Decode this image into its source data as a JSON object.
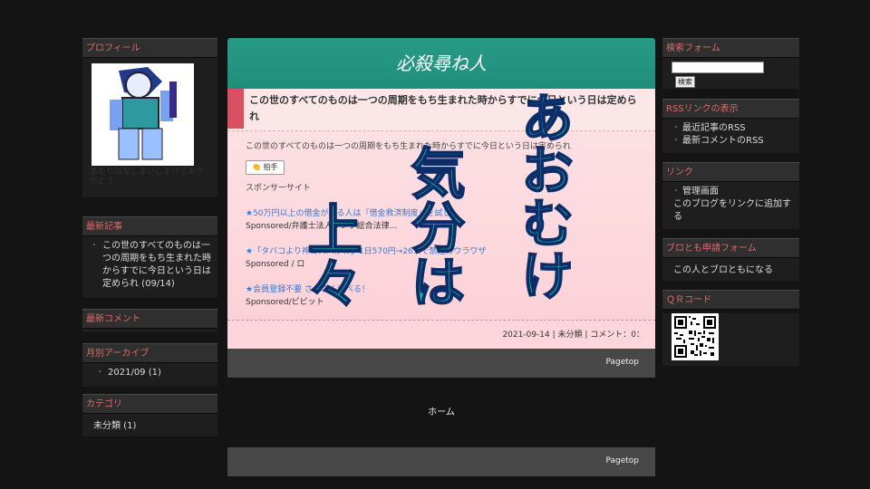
{
  "left": {
    "profile": {
      "title": "プロフィール",
      "text": "あたりはなしまいしまけるありがとう"
    },
    "recent": {
      "title": "最新記事",
      "item": "この世のすべてのものは一つの周期をもち生まれた時からすでに今日という日は定められ (09/14)"
    },
    "comments": {
      "title": "最新コメント"
    },
    "archive": {
      "title": "月別アーカイブ",
      "item": "2021/09 (1)"
    },
    "category": {
      "title": "カテゴリ",
      "item": "未分類 (1)"
    }
  },
  "main": {
    "blog_title": "必殺尋ね人",
    "entry_title": "この世のすべてのものは一つの周期をもち生まれた時からすでに今日という日は定められ",
    "entry_text": "この世のすべてのものは一つの周期をもち生まれた時からすでに今日という日は定められ",
    "clap": "拍手",
    "sponsor": "スポンサーサイト",
    "ads": [
      {
        "link": "★50万円以上の借金がある人は『借金救済制度』を試し",
        "sub": "Sponsored/弁護士法人ランク総合法律..."
      },
      {
        "link": "★「タバコより神コスパかわ」1日570円→26...で禁煙のウラワザ",
        "sub": "Sponsored / ロ"
      },
      {
        "link": "★会員登録不要 さくさく遊べる！",
        "sub": "Sponsored/ビビット"
      }
    ],
    "footer": "2021-09-14 | 未分類 | コメント：0：",
    "pagetop": "Pagetop",
    "home": "ホーム"
  },
  "right": {
    "search": {
      "title": "検索フォーム",
      "button": "検索",
      "value": ""
    },
    "rss": {
      "title": "RSSリンクの表示",
      "items": [
        "最近記事のRSS",
        "最新コメントのRSS"
      ]
    },
    "links": {
      "title": "リンク",
      "items": [
        "管理画面",
        "このブログをリンクに追加する"
      ]
    },
    "friend": {
      "title": "ブロとも申請フォーム",
      "item": "この人とブロともになる"
    },
    "qr": {
      "title": "ＱＲコード"
    }
  },
  "overlay": {
    "col1": "あおむけ",
    "col2": "気分は",
    "col3": "上々"
  },
  "colors": {
    "accent": "#1f8f7c",
    "heading": "#e06a6a",
    "overlay_fill": "#15c2a0",
    "overlay_stroke": "#0d2d6a"
  }
}
